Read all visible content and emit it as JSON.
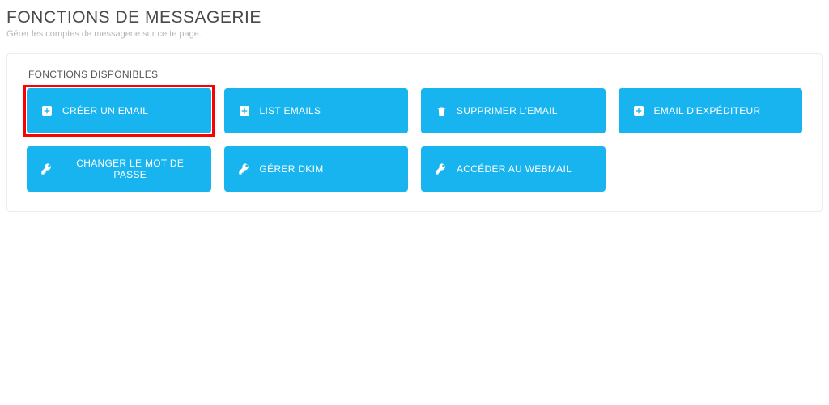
{
  "header": {
    "title": "FONCTIONS DE MESSAGERIE",
    "subtitle": "Gérer les comptes de messagerie sur cette page."
  },
  "panel": {
    "label": "FONCTIONS DISPONIBLES"
  },
  "buttons": {
    "create_email": "CRÉER UN EMAIL",
    "list_emails": "LIST EMAILS",
    "delete_email": "SUPPRIMER L'EMAIL",
    "sender_email": "EMAIL D'EXPÉDITEUR",
    "change_password": "CHANGER LE MOT DE PASSE",
    "manage_dkim": "GÉRER DKIM",
    "access_webmail": "ACCÉDER AU WEBMAIL"
  },
  "highlight": {
    "target": "create_email",
    "color": "#ff0000"
  }
}
